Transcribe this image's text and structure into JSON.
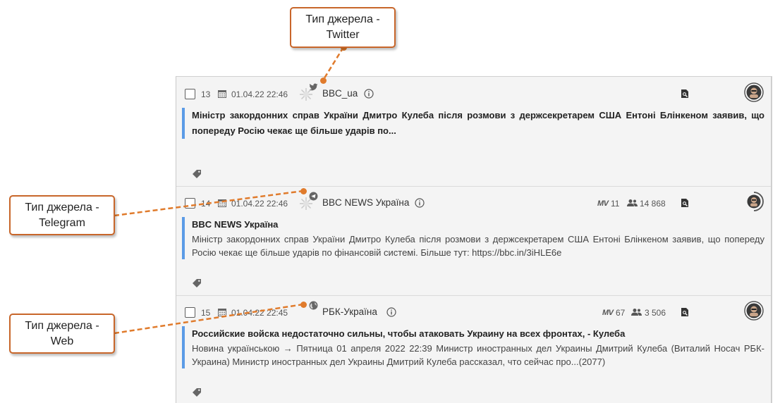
{
  "callouts": [
    {
      "line1": "Тип джерела -",
      "line2": "Twitter"
    },
    {
      "line1": "Тип джерела -",
      "line2": "Telegram"
    },
    {
      "line1": "Тип джерела -",
      "line2": "Web"
    }
  ],
  "items": [
    {
      "num": "13",
      "date": "01.04.22 22:46",
      "source": "BBC_ua",
      "source_type": "twitter-icon",
      "title": "Міністр закордонних справ України Дмитро Кулеба після розмови з держсекретарем США Ентоні Блінкеном заявив, що попереду Росію чекає ще більше ударів по...",
      "text": ""
    },
    {
      "num": "14",
      "date": "01.04.22 22:46",
      "source": "BBC NEWS Україна",
      "source_type": "telegram-icon",
      "mv_label": "MV",
      "mv": "11",
      "audience": "14 868",
      "title": "BBC NEWS Україна",
      "text": "Міністр закордонних справ України Дмитро Кулеба після розмови з держсекретарем США Ентоні Блінкеном заявив, що попереду Росію чекає ще більше ударів по фінансовій системі. Більше тут: https://bbc.in/3iHLE6e"
    },
    {
      "num": "15",
      "date": "01.04.22 22:45",
      "source": "РБК-Україна",
      "source_type": "web-globe-icon",
      "mv_label": "MV",
      "mv": "67",
      "audience": "3 506",
      "title": "Российские войска недостаточно сильны, чтобы атаковать Украину на всех фронтах, - Кулеба",
      "text": "Новина українською → Пятница 01 апреля 2022 22:39 Министр иностранных дел Украины Дмитрий Кулеба (Виталий Носач РБК-Украина) Министр иностранных дел Украины Дмитрий Кулеба рассказал, что сейчас про...(2077)"
    }
  ],
  "colors": {
    "accent_bar": "#5b9be6",
    "callout_border": "#c8662a",
    "callout_line": "#e07b2c"
  }
}
